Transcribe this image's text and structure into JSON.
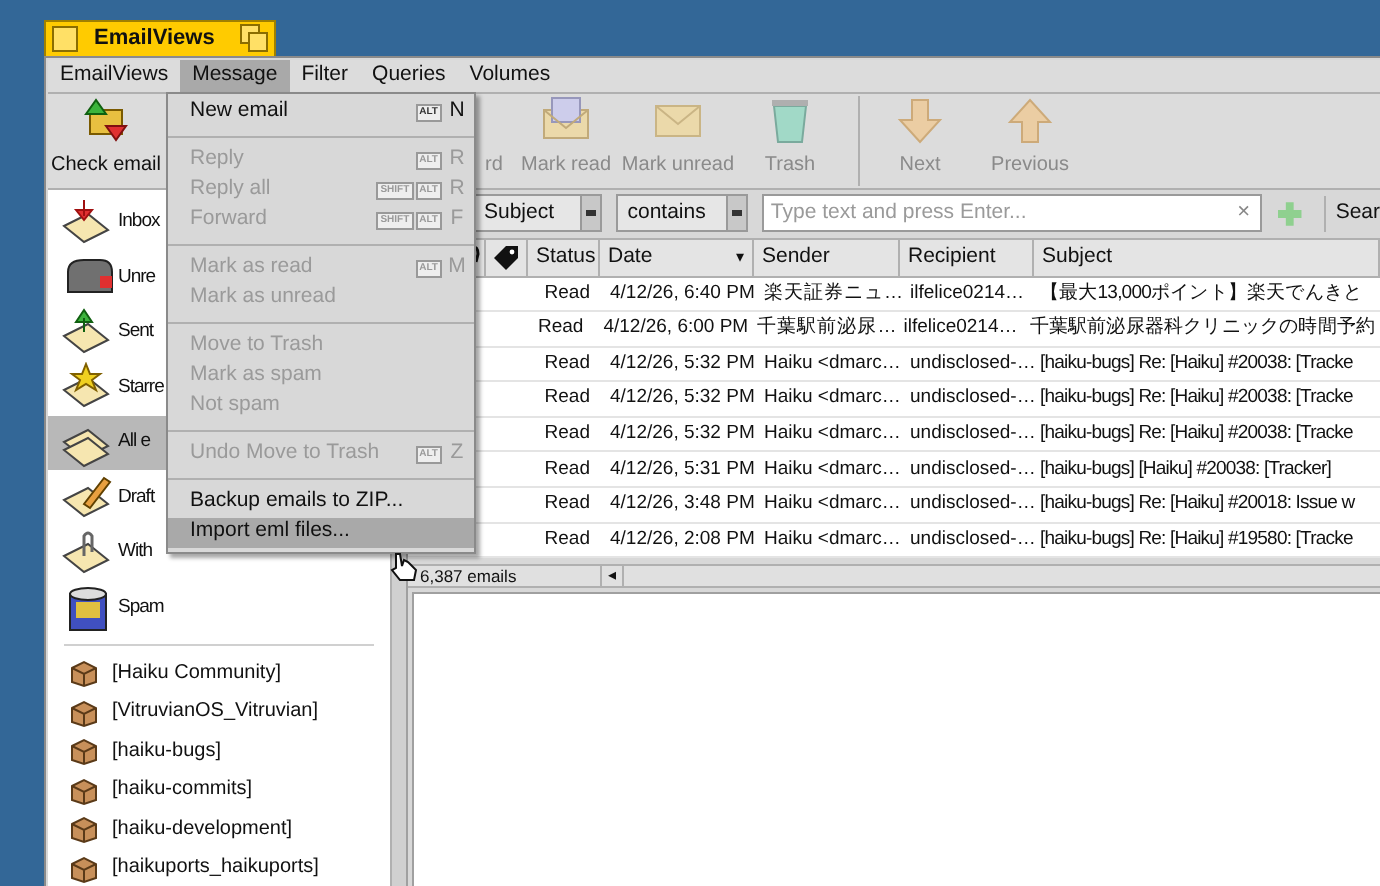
{
  "window": {
    "title": "EmailViews"
  },
  "menu_bar": [
    {
      "label": "EmailViews",
      "selected": false
    },
    {
      "label": "Message",
      "selected": true
    },
    {
      "label": "Filter",
      "selected": false
    },
    {
      "label": "Queries",
      "selected": false
    },
    {
      "label": "Volumes",
      "selected": false
    }
  ],
  "toolbar": [
    {
      "label": "Check email",
      "kind": "check",
      "disabled": false
    },
    {
      "label": "rd",
      "kind": "hidden",
      "disabled": true
    },
    {
      "label": "Mark read",
      "kind": "read",
      "disabled": true
    },
    {
      "label": "Mark unread",
      "kind": "unread",
      "disabled": true
    },
    {
      "label": "Trash",
      "kind": "trash",
      "disabled": true
    },
    {
      "kind": "separator"
    },
    {
      "label": "Next",
      "kind": "next",
      "disabled": true
    },
    {
      "label": "Previous",
      "kind": "previous",
      "disabled": true
    }
  ],
  "sidebar": {
    "items": [
      {
        "label": "Inbox",
        "kind": "inbox",
        "selected": false
      },
      {
        "label": "Unre",
        "kind": "unread",
        "selected": false
      },
      {
        "label": "Sent",
        "kind": "sent",
        "selected": false
      },
      {
        "label": "Starre",
        "kind": "starred",
        "selected": false
      },
      {
        "label": "All e",
        "kind": "all",
        "selected": true
      },
      {
        "label": "Draft",
        "kind": "drafts",
        "selected": false
      },
      {
        "label": "With",
        "kind": "attachments",
        "selected": false
      },
      {
        "label": "Spam",
        "kind": "spam",
        "selected": false
      }
    ],
    "queries": [
      "[Haiku Community]",
      "[VitruvianOS_Vitruvian]",
      "[haiku-bugs]",
      "[haiku-commits]",
      "[haiku-development]",
      "[haikuports_haikuports]"
    ]
  },
  "filter_bar": {
    "field": "Subject",
    "operator": "contains",
    "search": {
      "placeholder": "Type text and press Enter...",
      "clear": "×"
    },
    "search_button": "Sear"
  },
  "table": {
    "columns": [
      "Status",
      "Date",
      "Sender",
      "Recipient",
      "Subject"
    ],
    "sort_indicator": "▾",
    "rows": [
      [
        "Read",
        "4/12/26, 6:40 PM",
        "楽天証券ニュ…",
        "ilfelice0214…",
        "【最大13,000ポイント】楽天でんきと"
      ],
      [
        "Read",
        "4/12/26, 6:00 PM",
        "千葉駅前泌尿…",
        "ilfelice0214…",
        "千葉駅前泌尿器科クリニックの時間予約"
      ],
      [
        "Read",
        "4/12/26, 5:32 PM",
        "Haiku <dmarc…",
        "undisclosed-…",
        "[haiku-bugs] Re: [Haiku] #20038: [Tracke"
      ],
      [
        "Read",
        "4/12/26, 5:32 PM",
        "Haiku <dmarc…",
        "undisclosed-…",
        "[haiku-bugs] Re: [Haiku] #20038: [Tracke"
      ],
      [
        "Read",
        "4/12/26, 5:32 PM",
        "Haiku <dmarc…",
        "undisclosed-…",
        "[haiku-bugs] Re: [Haiku] #20038: [Tracke"
      ],
      [
        "Read",
        "4/12/26, 5:31 PM",
        "Haiku <dmarc…",
        "undisclosed-…",
        "[haiku-bugs] [Haiku] #20038: [Tracker]"
      ],
      [
        "Read",
        "4/12/26, 3:48 PM",
        "Haiku <dmarc…",
        "undisclosed-…",
        "[haiku-bugs] Re: [Haiku] #20018: Issue w"
      ],
      [
        "Read",
        "4/12/26, 2:08 PM",
        "Haiku <dmarc…",
        "undisclosed-…",
        "[haiku-bugs] Re: [Haiku] #19580: [Tracke"
      ]
    ]
  },
  "status_bar": {
    "count": "6,387 emails",
    "scroll_arrow": "◂"
  },
  "open_menu": [
    {
      "kind": "item",
      "label": "New email",
      "disabled": false,
      "highlighted": false,
      "keys": [
        "ALT"
      ],
      "key": "N"
    },
    {
      "kind": "separator"
    },
    {
      "kind": "item",
      "label": "Reply",
      "disabled": true,
      "highlighted": false,
      "keys": [
        "ALT"
      ],
      "key": "R"
    },
    {
      "kind": "item",
      "label": "Reply all",
      "disabled": true,
      "highlighted": false,
      "keys": [
        "SHIFT",
        "ALT"
      ],
      "key": "R"
    },
    {
      "kind": "item",
      "label": "Forward",
      "disabled": true,
      "highlighted": false,
      "keys": [
        "SHIFT",
        "ALT"
      ],
      "key": "F"
    },
    {
      "kind": "separator"
    },
    {
      "kind": "item",
      "label": "Mark as read",
      "disabled": true,
      "highlighted": false,
      "keys": [
        "ALT"
      ],
      "key": "M"
    },
    {
      "kind": "item",
      "label": "Mark as unread",
      "disabled": true,
      "highlighted": false
    },
    {
      "kind": "separator"
    },
    {
      "kind": "item",
      "label": "Move to Trash",
      "disabled": true,
      "highlighted": false
    },
    {
      "kind": "item",
      "label": "Mark as spam",
      "disabled": true,
      "highlighted": false
    },
    {
      "kind": "item",
      "label": "Not spam",
      "disabled": true,
      "highlighted": false
    },
    {
      "kind": "separator"
    },
    {
      "kind": "item",
      "label": "Undo Move to Trash",
      "disabled": true,
      "highlighted": false,
      "keys": [
        "ALT"
      ],
      "key": "Z"
    },
    {
      "kind": "separator"
    },
    {
      "kind": "item",
      "label": "Backup emails to ZIP...",
      "disabled": false,
      "highlighted": false
    },
    {
      "kind": "item",
      "label": "Import eml files...",
      "disabled": false,
      "highlighted": true
    }
  ]
}
